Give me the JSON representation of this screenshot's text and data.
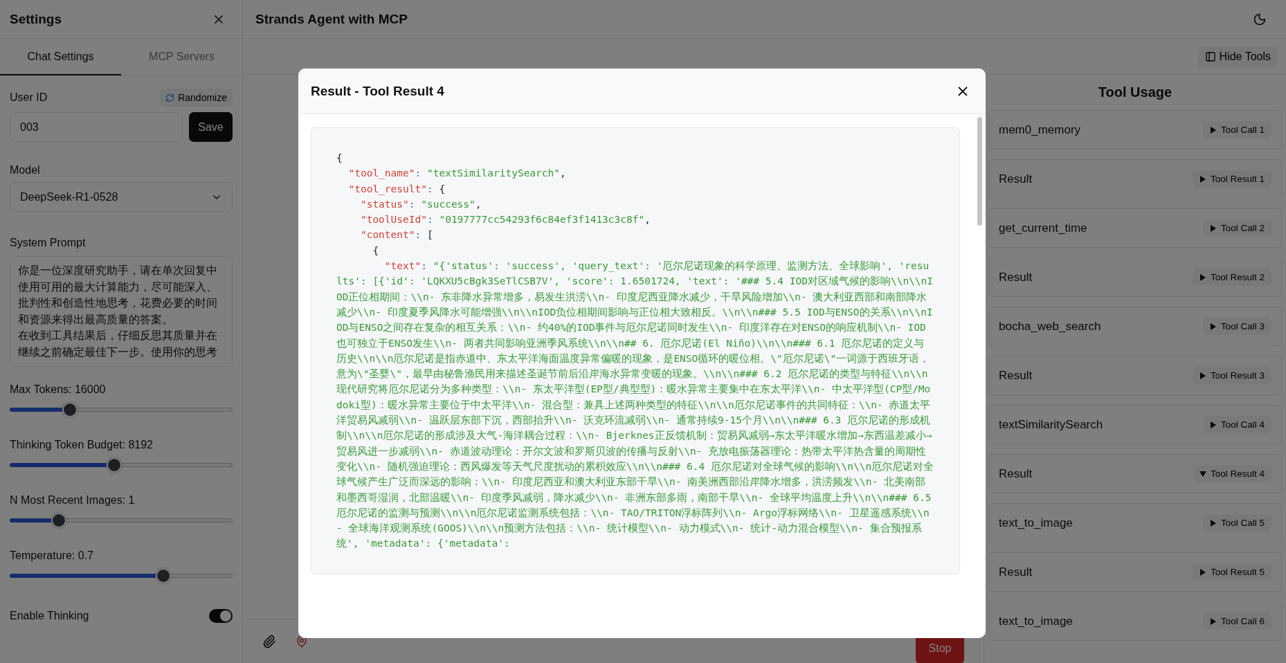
{
  "sidebar": {
    "title": "Settings",
    "tabs": [
      {
        "label": "Chat Settings",
        "selected": true
      },
      {
        "label": "MCP Servers",
        "selected": false
      }
    ],
    "user_id": {
      "label": "User ID",
      "randomize": "Randomize",
      "value": "003",
      "save": "Save"
    },
    "model": {
      "label": "Model",
      "value": "DeepSeek-R1-0528"
    },
    "system_prompt": {
      "label": "System Prompt",
      "paragraphs": [
        "你是一位深度研究助手，请在单次回复中使用可用的最大计算能力，尽可能深入、批判性和创造性地思考，花费必要的时间和资源来得出最高质量的答案。",
        "在收到工具结果后，仔细反思其质量并在继续之前确定最佳下一步。使用你的思考"
      ]
    },
    "sliders": [
      {
        "label": "Max Tokens: 16000",
        "level": 0.27
      },
      {
        "label": "Thinking Token Budget: 8192",
        "level": 0.47
      },
      {
        "label": "N Most Recent Images: 1",
        "level": 0.22
      },
      {
        "label": "Temperature: 0.7",
        "level": 0.69
      }
    ],
    "enable_thinking": {
      "label": "Enable Thinking",
      "on": true
    }
  },
  "header": {
    "title": "Strands Agent with MCP"
  },
  "toolbar": {
    "hide_tools": "Hide Tools"
  },
  "composer": {
    "stop": "Stop"
  },
  "tool_panel": {
    "title": "Tool Usage",
    "items": [
      {
        "name": "mem0_memory",
        "button": "Tool Call 1",
        "expanded": false
      },
      {
        "name": "Result",
        "button": "Tool Result 1",
        "expanded": false
      },
      {
        "name": "get_current_time",
        "button": "Tool Call 2",
        "expanded": false
      },
      {
        "name": "Result",
        "button": "Tool Result 2",
        "expanded": false
      },
      {
        "name": "bocha_web_search",
        "button": "Tool Call 3",
        "expanded": false
      },
      {
        "name": "Result",
        "button": "Tool Result 3",
        "expanded": false
      },
      {
        "name": "textSimilaritySearch",
        "button": "Tool Call 4",
        "expanded": false
      },
      {
        "name": "Result",
        "button": "Tool Result 4",
        "expanded": true
      },
      {
        "name": "text_to_image",
        "button": "Tool Call 5",
        "expanded": false
      },
      {
        "name": "Result",
        "button": "Tool Result 5",
        "expanded": false
      },
      {
        "name": "text_to_image",
        "button": "Tool Call 6",
        "expanded": false
      }
    ]
  },
  "modal": {
    "title": "Result - Tool Result 4",
    "code_lines": [
      [
        {
          "kind": "punct",
          "text": "{"
        }
      ],
      [
        {
          "kind": "key",
          "text": "  \"tool_name\""
        },
        {
          "kind": "colon",
          "text": ": "
        },
        {
          "kind": "string",
          "text": "\"textSimilaritySearch\""
        },
        {
          "kind": "punct",
          "text": ","
        }
      ],
      [
        {
          "kind": "key",
          "text": "  \"tool_result\""
        },
        {
          "kind": "colon",
          "text": ": "
        },
        {
          "kind": "punct",
          "text": "{"
        }
      ],
      [
        {
          "kind": "key",
          "text": "    \"status\""
        },
        {
          "kind": "colon",
          "text": ": "
        },
        {
          "kind": "string",
          "text": "\"success\""
        },
        {
          "kind": "punct",
          "text": ","
        }
      ],
      [
        {
          "kind": "key",
          "text": "    \"toolUseId\""
        },
        {
          "kind": "colon",
          "text": ": "
        },
        {
          "kind": "string",
          "text": "\"0197777cc54293f6c84ef3f1413c3c8f\""
        },
        {
          "kind": "punct",
          "text": ","
        }
      ],
      [
        {
          "kind": "key",
          "text": "    \"content\""
        },
        {
          "kind": "colon",
          "text": ": "
        },
        {
          "kind": "punct",
          "text": "["
        }
      ],
      [
        {
          "kind": "punct",
          "text": "      {"
        }
      ],
      [
        {
          "kind": "key",
          "text": "        \"text\""
        },
        {
          "kind": "colon",
          "text": ": "
        },
        {
          "kind": "string",
          "text": "\"{'status': 'success', 'query_text': '厄尔尼诺现象的科学原理、监测方法、全球影响', 'results': [{'id': 'LQKXU5cBgk3SeTlCSB7V', 'score': 1.6501724, 'text': '### 5.4 IOD对区域气候的影响\\\\n\\\\nIOD正位相期间：\\\\n- 东非降水异常增多，易发生洪涝\\\\n- 印度尼西亚降水减少，干旱风险增加\\\\n- 澳大利亚西部和南部降水减少\\\\n- 印度夏季风降水可能增强\\\\n\\\\nIOD负位相期间影响与正位相大致相反。\\\\n\\\\n### 5.5 IOD与ENSO的关系\\\\n\\\\nIOD与ENSO之间存在复杂的相互关系：\\\\n- 约40%的IOD事件与厄尔尼诺同时发生\\\\n- 印度洋存在对ENSO的响应机制\\\\n- IOD也可独立于ENSO发生\\\\n- 两者共同影响亚洲季风系统\\\\n\\\\n## 6. 厄尔尼诺(El Niño)\\\\n\\\\n### 6.1 厄尔尼诺的定义与历史\\\\n\\\\n厄尔尼诺是指赤道中、东太平洋海面温度异常偏暖的现象，是ENSO循环的暖位相。\\\"厄尔尼诺\\\"一词源于西班牙语，意为\\\"圣婴\\\"，最早由秘鲁渔民用来描述圣诞节前后沿岸海水异常变暖的现象。\\\\n\\\\n### 6.2 厄尔尼诺的类型与特征\\\\n\\\\n现代研究将厄尔尼诺分为多种类型：\\\\n- 东太平洋型(EP型/典型型)：暖水异常主要集中在东太平洋\\\\n- 中太平洋型(CP型/Modoki型)：暖水异常主要位于中太平洋\\\\n- 混合型：兼具上述两种类型的特征\\\\n\\\\n厄尔尼诺事件的共同特征：\\\\n- 赤道太平洋贸易风减弱\\\\n- 温跃层东部下沉，西部抬升\\\\n- 沃克环流减弱\\\\n- 通常持续9-15个月\\\\n\\\\n### 6.3 厄尔尼诺的形成机制\\\\n\\\\n厄尔尼诺的形成涉及大气-海洋耦合过程：\\\\n- Bjerknes正反馈机制：贸易风减弱→东太平洋暖水增加→东西温差减小→贸易风进一步减弱\\\\n- 赤道波动理论：开尔文波和罗斯贝波的传播与反射\\\\n- 充放电振荡器理论：热带太平洋热含量的周期性变化\\\\n- 随机强迫理论：西风爆发等天气尺度扰动的累积效应\\\\n\\\\n### 6.4 厄尔尼诺对全球气候的影响\\\\n\\\\n厄尔尼诺对全球气候产生广泛而深远的影响：\\\\n- 印度尼西亚和澳大利亚东部干旱\\\\n- 南美洲西部沿岸降水增多，洪涝频发\\\\n- 北美南部和墨西哥湿润，北部温暖\\\\n- 印度季风减弱，降水减少\\\\n- 非洲东部多雨，南部干旱\\\\n- 全球平均温度上升\\\\n\\\\n### 6.5 厄尔尼诺的监测与预测\\\\n\\\\n厄尔尼诺监测系统包括：\\\\n- TAO/TRITON浮标阵列\\\\n- Argo浮标网络\\\\n- 卫星遥感系统\\\\n- 全球海洋观测系统(GOOS)\\\\n\\\\n预测方法包括：\\\\n- 统计模型\\\\n- 动力模式\\\\n- 统计-动力混合模型\\\\n- 集合预报系统', 'metadata': {'metadata':"
        }
      ]
    ]
  }
}
